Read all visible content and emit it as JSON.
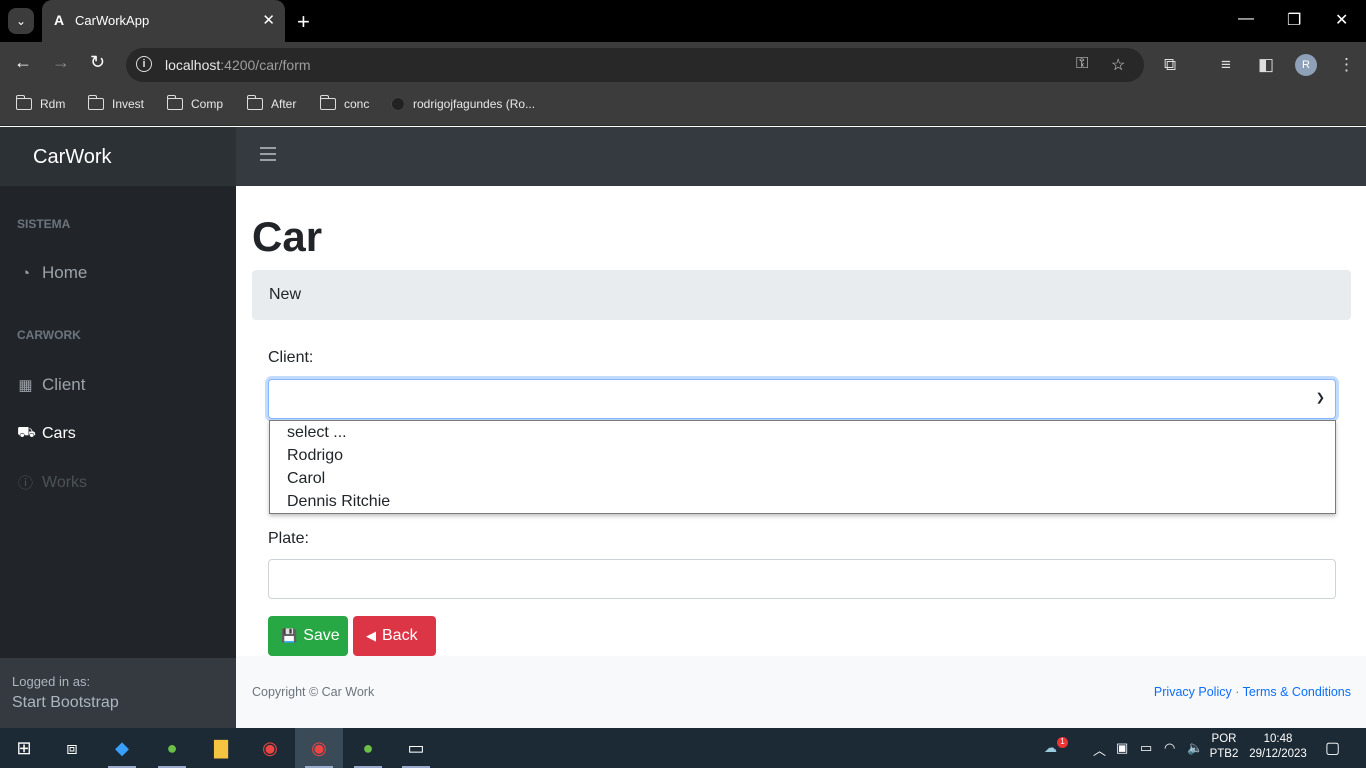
{
  "browser": {
    "tab_title": "CarWorkApp",
    "url_host": "localhost",
    "url_path": ":4200/car/form",
    "bookmarks": [
      "Rdm",
      "Invest",
      "Comp",
      "After",
      "conc",
      "rodrigojfagundes (Ro..."
    ],
    "profile_initial": "R"
  },
  "app": {
    "brand": "CarWork"
  },
  "sidebar": {
    "sections": [
      {
        "heading": "SISTEMA",
        "items": [
          {
            "label": "Home",
            "icon": "dashboard-icon"
          }
        ]
      },
      {
        "heading": "CARWORK",
        "items": [
          {
            "label": "Client",
            "icon": "table-icon"
          },
          {
            "label": "Cars",
            "icon": "car-icon",
            "active": true
          },
          {
            "label": "Works",
            "icon": "info-icon",
            "disabled": true
          }
        ]
      }
    ],
    "footer_small": "Logged in as:",
    "footer_big": "Start Bootstrap"
  },
  "main": {
    "title": "Car",
    "breadcrumb": "New",
    "client_label": "Client:",
    "client_value": "",
    "client_options": [
      "select ...",
      "Rodrigo",
      "Carol",
      "Dennis Ritchie"
    ],
    "plate_label": "Plate:",
    "plate_value": "",
    "save_label": "Save",
    "back_label": "Back"
  },
  "footer": {
    "copyright": "Copyright © Car Work",
    "privacy": "Privacy Policy",
    "separator": "·",
    "terms": "Terms & Conditions"
  },
  "taskbar": {
    "lang_top": "POR",
    "lang_bottom": "PTB2",
    "time": "10:48",
    "date": "29/12/2023",
    "weather_badge": "1"
  },
  "colors": {
    "sidebar_bg": "#212529",
    "topnav_bg": "#343a40",
    "save": "#28a745",
    "back": "#dc3545",
    "link": "#0d6efd"
  }
}
